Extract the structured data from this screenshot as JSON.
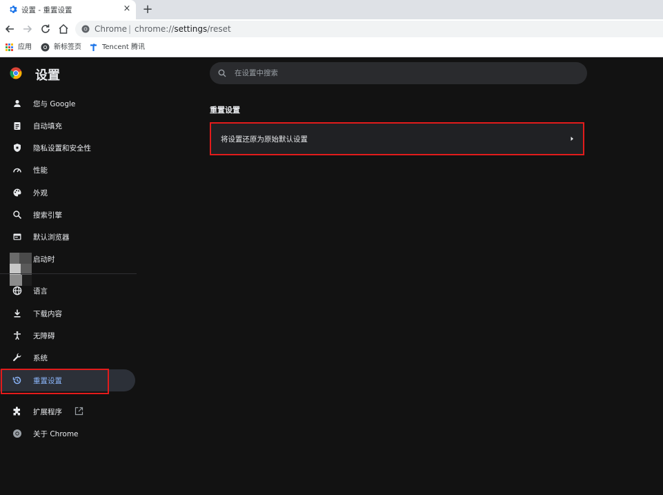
{
  "tab": {
    "title": "设置 - 重置设置",
    "close": "×",
    "new_tab": "+"
  },
  "omnibox": {
    "site": "Chrome",
    "separator": "|",
    "scheme": "chrome://",
    "host": "settings",
    "path": "/reset"
  },
  "bookmarks": [
    {
      "label": "应用",
      "icon": "apps-grid-icon"
    },
    {
      "label": "新标签页",
      "icon": "chrome-newtab-icon"
    },
    {
      "label": "Tencent 腾讯",
      "icon": "tencent-icon"
    }
  ],
  "settings": {
    "title": "设置",
    "search_placeholder": "在设置中搜索",
    "nav": [
      {
        "label": "您与 Google",
        "icon": "person-icon"
      },
      {
        "label": "自动填充",
        "icon": "clipboard-icon"
      },
      {
        "label": "隐私设置和安全性",
        "icon": "shield-icon"
      },
      {
        "label": "性能",
        "icon": "speedometer-icon"
      },
      {
        "label": "外观",
        "icon": "palette-icon"
      },
      {
        "label": "搜索引擎",
        "icon": "search-icon"
      },
      {
        "label": "默认浏览器",
        "icon": "browser-icon"
      },
      {
        "label": "启动时",
        "icon": "power-icon"
      },
      {
        "label": "语言",
        "icon": "globe-icon"
      },
      {
        "label": "下载内容",
        "icon": "download-icon"
      },
      {
        "label": "无障碍",
        "icon": "accessibility-icon"
      },
      {
        "label": "系统",
        "icon": "wrench-icon"
      },
      {
        "label": "重置设置",
        "icon": "restore-icon",
        "active": true
      },
      {
        "label": "扩展程序",
        "icon": "puzzle-icon"
      },
      {
        "label": "关于 Chrome",
        "icon": "chrome-icon"
      }
    ],
    "section_title": "重置设置",
    "reset_row_label": "将设置还原为原始默认设置"
  },
  "colors": {
    "background": "#121212",
    "accent": "#8ab4f8",
    "highlight": "#e31b1b",
    "card": "#202124"
  }
}
